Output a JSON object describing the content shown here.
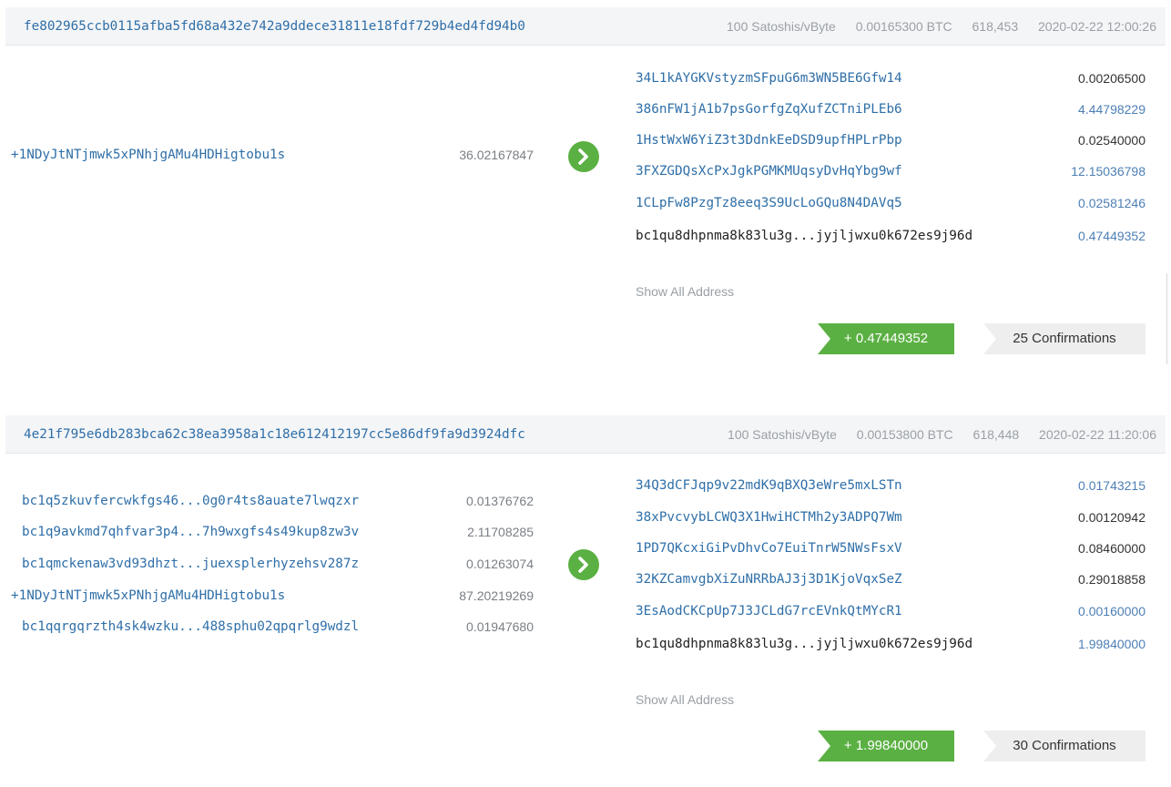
{
  "transactions": [
    {
      "hash": "fe802965ccb0115afba5fd68a432e742a9ddece31811e18fdf729b4ed4fd94b0",
      "fee_rate": "100 Satoshis/vByte",
      "fee": "0.00165300 BTC",
      "block": "618,453",
      "time": "2020-02-22 12:00:26",
      "inputs": [
        {
          "address": "+1NDyJtNTjmwk5xPNhjgAMu4HDHigtobu1s",
          "amount": "36.02167847"
        }
      ],
      "outputs": [
        {
          "address": "34L1kAYGKVstyzmSFpuG6m3WN5BE6Gfw14",
          "amount": "0.00206500"
        },
        {
          "address": "386nFW1jA1b7psGorfgZqXufZCTniPLEb6",
          "amount": "4.44798229"
        },
        {
          "address": "1HstWxW6YiZ3t3DdnkEeDSD9upfHPLrPbp",
          "amount": "0.02540000"
        },
        {
          "address": "3FXZGDQsXcPxJgkPGMKMUqsyDvHqYbg9wf",
          "amount": "12.15036798"
        },
        {
          "address": "1CLpFw8PzgTz8eeq3S9UcLoGQu8N4DAVq5",
          "amount": "0.02581246"
        },
        {
          "address": "bc1qu8dhpnma8k83lu3g...jyjljwxu0k672es9j96d",
          "amount": "0.47449352"
        }
      ],
      "show_all": "Show All Address",
      "net_amount": "+ 0.47449352",
      "confirmations": "25 Confirmations"
    },
    {
      "hash": "4e21f795e6db283bca62c38ea3958a1c18e612412197cc5e86df9fa9d3924dfc",
      "fee_rate": "100 Satoshis/vByte",
      "fee": "0.00153800 BTC",
      "block": "618,448",
      "time": "2020-02-22 11:20:06",
      "inputs": [
        {
          "address": "bc1q5zkuvfercwkfgs46...0g0r4ts8auate7lwqzxr",
          "amount": "0.01376762"
        },
        {
          "address": "bc1q9avkmd7qhfvar3p4...7h9wxgfs4s49kup8zw3v",
          "amount": "2.11708285"
        },
        {
          "address": "bc1qmckenaw3vd93dhzt...juexsplerhyzehsv287z",
          "amount": "0.01263074"
        },
        {
          "address": "+1NDyJtNTjmwk5xPNhjgAMu4HDHigtobu1s",
          "amount": "87.20219269"
        },
        {
          "address": "bc1qqrgqrzth4sk4wzku...488sphu02qpqrlg9wdzl",
          "amount": "0.01947680"
        }
      ],
      "outputs": [
        {
          "address": "34Q3dCFJqp9v22mdK9qBXQ3eWre5mxLSTn",
          "amount": "0.01743215"
        },
        {
          "address": "38xPvcvybLCWQ3X1HwiHCTMh2y3ADPQ7Wm",
          "amount": "0.00120942"
        },
        {
          "address": "1PD7QKcxiGiPvDhvCo7EuiTnrW5NWsFsxV",
          "amount": "0.08460000"
        },
        {
          "address": "32KZCamvgbXiZuNRRbAJ3j3D1KjoVqxSeZ",
          "amount": "0.29018858"
        },
        {
          "address": "3EsAodCKCpUp7J3JCLdG7rcEVnkQtMYcR1",
          "amount": "0.00160000"
        },
        {
          "address": "bc1qu8dhpnma8k83lu3g...jyjljwxu0k672es9j96d",
          "amount": "1.99840000"
        }
      ],
      "show_all": "Show All Address",
      "net_amount": "+ 1.99840000",
      "confirmations": "30 Confirmations"
    }
  ],
  "colors": {
    "link": "#2f6fa8",
    "green": "#5bb043",
    "muted": "#9aa0a6",
    "header_bg": "#f4f5f7"
  },
  "icons": {
    "arrow": "chevron-right-icon"
  }
}
